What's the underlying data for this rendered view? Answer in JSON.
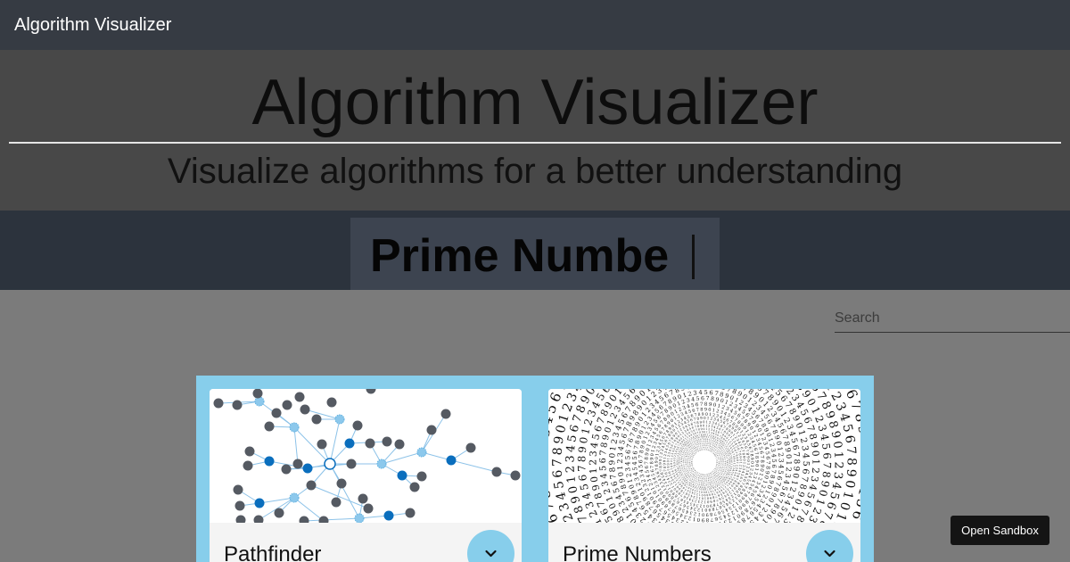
{
  "navbar": {
    "brand": "Algorithm Visualizer"
  },
  "hero": {
    "title": "Algorithm Visualizer",
    "subtitle": "Visualize algorithms for a better understanding"
  },
  "typewriter": {
    "text": "Prime Numbe"
  },
  "search": {
    "placeholder": "Search",
    "value": ""
  },
  "cards": [
    {
      "title": "Pathfinder",
      "image": "graph-network-thumbnail",
      "expand_icon": "chevron-down-icon"
    },
    {
      "title": "Prime Numbers",
      "image": "number-spiral-thumbnail",
      "expand_icon": "chevron-down-icon"
    }
  ],
  "sandbox_button": {
    "label": "Open Sandbox"
  },
  "colors": {
    "navbar": "#363b43",
    "hero": "#484848",
    "typeband": "#2c333d",
    "cards_bg": "#87ceeb",
    "accent": "#87ceeb",
    "node_blue": "#0a6ebd",
    "node_gray": "#555a62"
  }
}
